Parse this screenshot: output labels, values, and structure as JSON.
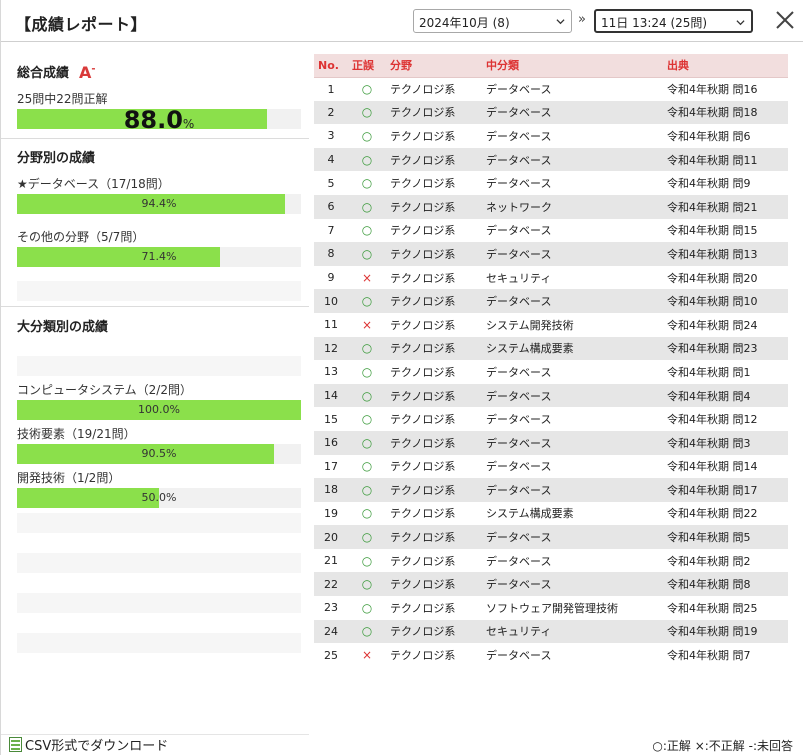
{
  "header": {
    "title": "【成績レポート】",
    "month_select": "2024年10月 (8)",
    "nav_arrow": "»",
    "session_select": "11日 13:24 (25問)"
  },
  "summary": {
    "title": "総合成績",
    "grade": "A",
    "grade_suffix": "-",
    "caption": "25問中22問正解",
    "score": "88.0",
    "unit": "%",
    "score_value": 0.88
  },
  "field": {
    "title": "分野別の成績",
    "items": [
      {
        "label": "★データベース（17/18問）",
        "pct": "94.4%",
        "value": 0.944
      },
      {
        "label": "その他の分野（5/7問）",
        "pct": "71.4%",
        "value": 0.714
      }
    ]
  },
  "major": {
    "title": "大分類別の成績",
    "items": [
      {
        "label": "コンピュータシステム（2/2問）",
        "pct": "100.0%",
        "value": 1.0
      },
      {
        "label": "技術要素（19/21問）",
        "pct": "90.5%",
        "value": 0.905
      },
      {
        "label": "開発技術（1/2問）",
        "pct": "50.0%",
        "value": 0.5
      }
    ]
  },
  "table": {
    "headers": [
      "No.",
      "正誤",
      "分野",
      "中分類",
      "出典"
    ],
    "rows": [
      [
        "1",
        "○",
        "テクノロジ系",
        "データベース",
        "令和4年秋期 問16"
      ],
      [
        "2",
        "○",
        "テクノロジ系",
        "データベース",
        "令和4年秋期 問18"
      ],
      [
        "3",
        "○",
        "テクノロジ系",
        "データベース",
        "令和4年秋期 問6"
      ],
      [
        "4",
        "○",
        "テクノロジ系",
        "データベース",
        "令和4年秋期 問11"
      ],
      [
        "5",
        "○",
        "テクノロジ系",
        "データベース",
        "令和4年秋期 問9"
      ],
      [
        "6",
        "○",
        "テクノロジ系",
        "ネットワーク",
        "令和4年秋期 問21"
      ],
      [
        "7",
        "○",
        "テクノロジ系",
        "データベース",
        "令和4年秋期 問15"
      ],
      [
        "8",
        "○",
        "テクノロジ系",
        "データベース",
        "令和4年秋期 問13"
      ],
      [
        "9",
        "×",
        "テクノロジ系",
        "セキュリティ",
        "令和4年秋期 問20"
      ],
      [
        "10",
        "○",
        "テクノロジ系",
        "データベース",
        "令和4年秋期 問10"
      ],
      [
        "11",
        "×",
        "テクノロジ系",
        "システム開発技術",
        "令和4年秋期 問24"
      ],
      [
        "12",
        "○",
        "テクノロジ系",
        "システム構成要素",
        "令和4年秋期 問23"
      ],
      [
        "13",
        "○",
        "テクノロジ系",
        "データベース",
        "令和4年秋期 問1"
      ],
      [
        "14",
        "○",
        "テクノロジ系",
        "データベース",
        "令和4年秋期 問4"
      ],
      [
        "15",
        "○",
        "テクノロジ系",
        "データベース",
        "令和4年秋期 問12"
      ],
      [
        "16",
        "○",
        "テクノロジ系",
        "データベース",
        "令和4年秋期 問3"
      ],
      [
        "17",
        "○",
        "テクノロジ系",
        "データベース",
        "令和4年秋期 問14"
      ],
      [
        "18",
        "○",
        "テクノロジ系",
        "データベース",
        "令和4年秋期 問17"
      ],
      [
        "19",
        "○",
        "テクノロジ系",
        "システム構成要素",
        "令和4年秋期 問22"
      ],
      [
        "20",
        "○",
        "テクノロジ系",
        "データベース",
        "令和4年秋期 問5"
      ],
      [
        "21",
        "○",
        "テクノロジ系",
        "データベース",
        "令和4年秋期 問2"
      ],
      [
        "22",
        "○",
        "テクノロジ系",
        "データベース",
        "令和4年秋期 問8"
      ],
      [
        "23",
        "○",
        "テクノロジ系",
        "ソフトウェア開発管理技術",
        "令和4年秋期 問25"
      ],
      [
        "24",
        "○",
        "テクノロジ系",
        "セキュリティ",
        "令和4年秋期 問19"
      ],
      [
        "25",
        "×",
        "テクノロジ系",
        "データベース",
        "令和4年秋期 問7"
      ]
    ]
  },
  "footer": {
    "csv_label": "CSV形式でダウンロード",
    "legend": "○:正解 ×:不正解 -:未回答"
  },
  "colors": {
    "bar_fill": "#8be04b",
    "grade": "#d93a3a",
    "header_bg": "#f2dede",
    "correct": "#3a9a3a",
    "wrong": "#dd3333"
  },
  "icons": {
    "month_chevron": "chevron-down-icon",
    "session_chevron": "chevron-down-icon",
    "close": "close-icon",
    "csv": "csv-file-icon"
  }
}
